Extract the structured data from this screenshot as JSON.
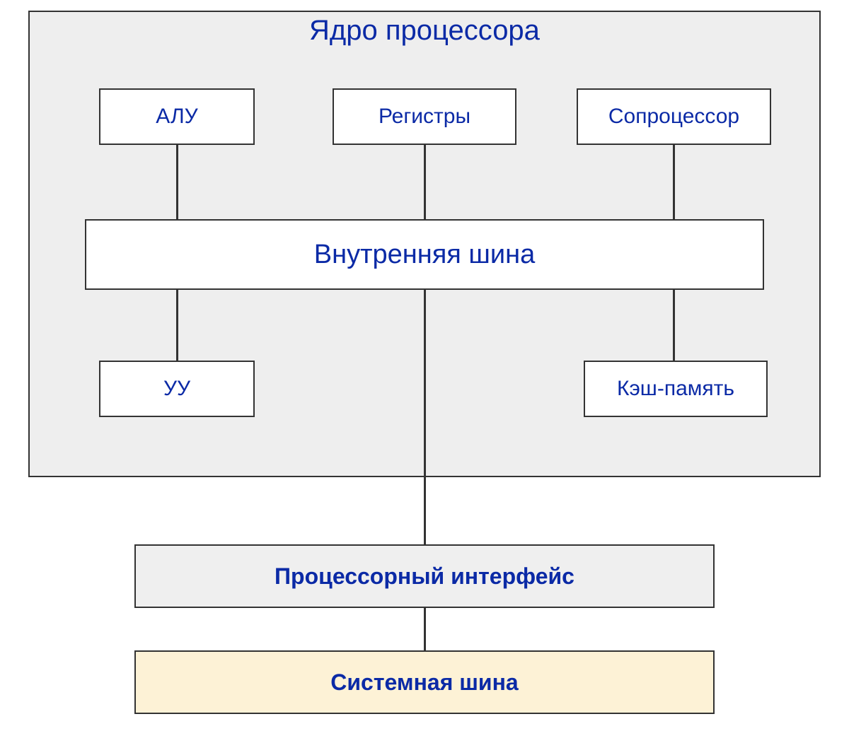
{
  "diagram": {
    "core_title": "Ядро процессора",
    "alu": "АЛУ",
    "registers": "Регистры",
    "coprocessor": "Сопроцессор",
    "internal_bus": "Внутренняя шина",
    "cu": "УУ",
    "cache": "Кэш-память",
    "processor_interface": "Процессорный интерфейс",
    "system_bus": "Системная шина"
  }
}
